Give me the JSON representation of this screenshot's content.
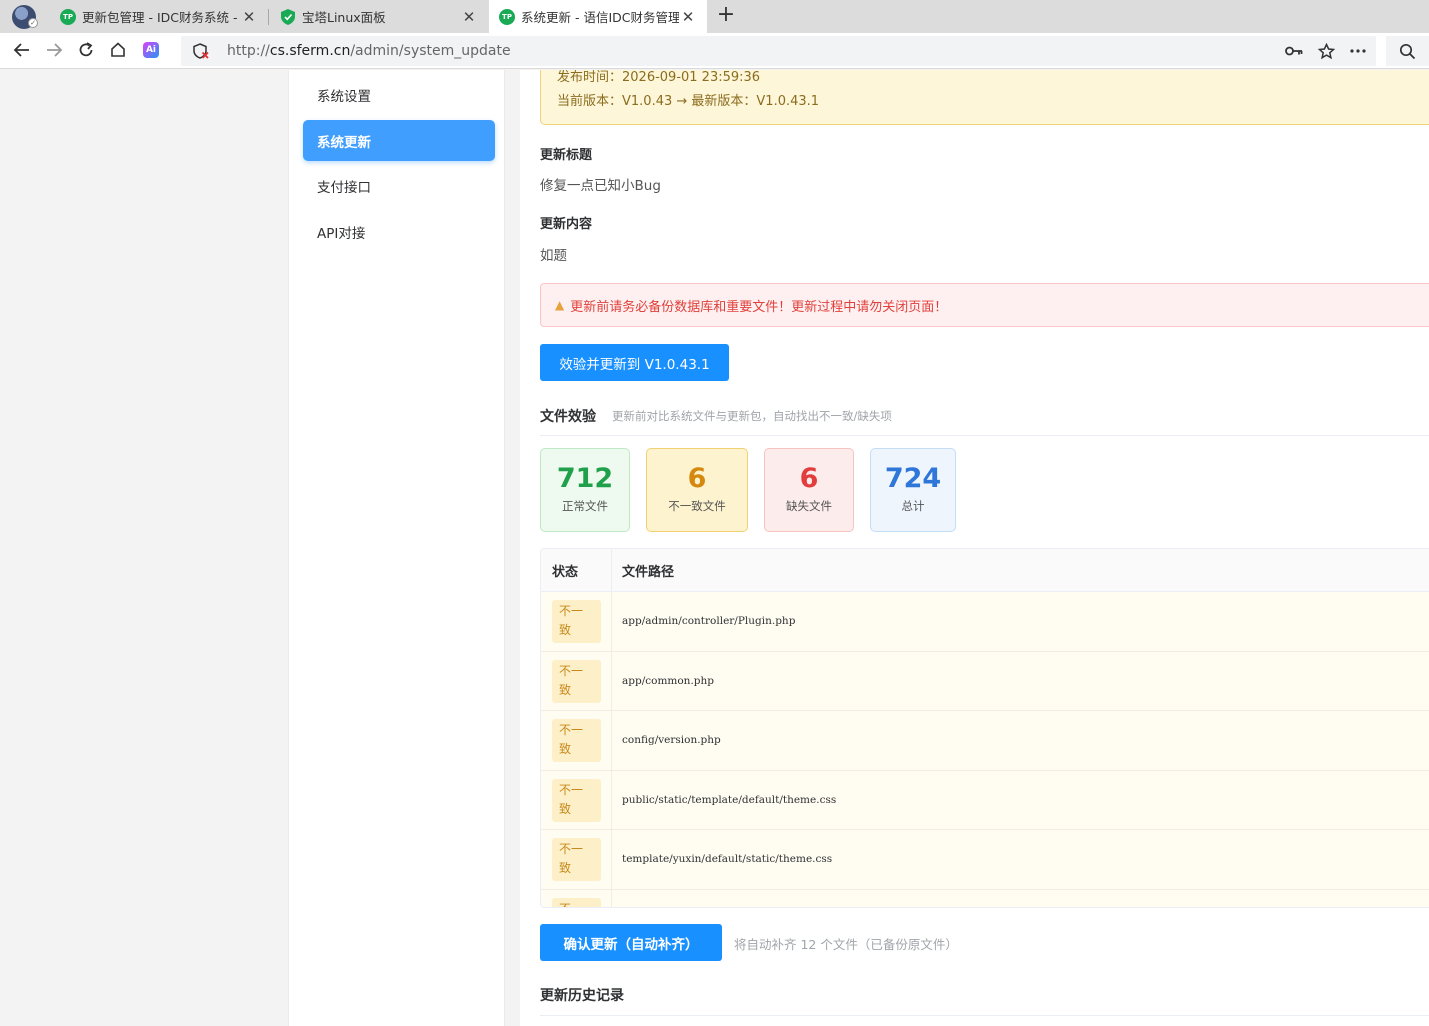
{
  "browser": {
    "tabs": [
      {
        "title": "更新包管理 - IDC财务系统 - ",
        "icon": "tp-favicon"
      },
      {
        "title": "宝塔Linux面板",
        "icon": "bt-shield-favicon"
      },
      {
        "title": "系统更新 - 语信IDC财务管理",
        "icon": "tp-favicon"
      }
    ],
    "favicon_text": "TP",
    "ai_label": "Ai",
    "url_scheme": "http://",
    "url_host": "cs.sferm.cn",
    "url_path": "/admin/system_update",
    "accent": "#1aaa55"
  },
  "sidebar": {
    "items": [
      {
        "label": "系统设置",
        "active": false
      },
      {
        "label": "系统更新",
        "active": true
      },
      {
        "label": "支付接口",
        "active": false
      },
      {
        "label": "API对接",
        "active": false
      }
    ]
  },
  "notice": {
    "publish_time": "发布时间：2026-09-01 23:59:36",
    "version_line": "当前版本：V1.0.43 → 最新版本：V1.0.43.1"
  },
  "update": {
    "title_label": "更新标题",
    "title_value": "修复一点已知小Bug",
    "content_label": "更新内容",
    "content_value": "如题"
  },
  "warning": {
    "text": "更新前请务必备份数据库和重要文件！更新过程中请勿关闭页面！"
  },
  "verify_update_button": "效验并更新到 V1.0.43.1",
  "file_check": {
    "title": "文件效验",
    "subtitle": "更新前对比系统文件与更新包，自动找出不一致/缺失项",
    "stats": [
      {
        "value": "712",
        "label": "正常文件",
        "color": "#20a04a"
      },
      {
        "value": "6",
        "label": "不一致文件",
        "color": "#d4880e"
      },
      {
        "value": "6",
        "label": "缺失文件",
        "color": "#e23c3c"
      },
      {
        "value": "724",
        "label": "总计",
        "color": "#2e76d8"
      }
    ]
  },
  "table": {
    "headers": [
      "状态",
      "文件路径"
    ],
    "rows": [
      {
        "status": "不一致",
        "path": "app/admin/controller/Plugin.php"
      },
      {
        "status": "不一致",
        "path": "app/common.php"
      },
      {
        "status": "不一致",
        "path": "config/version.php"
      },
      {
        "status": "不一致",
        "path": "public/static/template/default/theme.css"
      },
      {
        "status": "不一致",
        "path": "template/yuxin/default/static/theme.css"
      },
      {
        "status": "不一致",
        "path": ""
      }
    ]
  },
  "confirm_button": "确认更新（自动补齐）",
  "auto_note": "将自动补齐 12 个文件（已备份原文件）",
  "history_title": "更新历史记录"
}
